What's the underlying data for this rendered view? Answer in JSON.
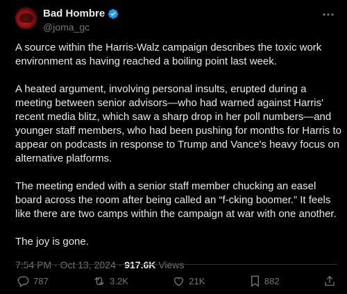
{
  "author": {
    "display_name": "Bad Hombre",
    "handle": "@joma_gc",
    "verified": true,
    "verified_color": "#1d9bf0"
  },
  "more_icon": "more-dots-icon",
  "tweet": {
    "paragraphs": [
      "A source within the Harris-Walz campaign describes the toxic work environment as having reached a boiling point last week.",
      "A heated argument, involving personal insults, erupted during a meeting between senior advisors—who had warned against Harris' recent media blitz, which saw a sharp drop in her poll numbers—and younger staff members, who had been pushing for months for Harris to appear on podcasts in response to Trump and Vance's heavy focus on alternative platforms.",
      "The meeting ended with a senior staff member chucking an easel board across the room after being called an “f-cking boomer.” It feels like there are two camps within the campaign at war with one another.",
      "The joy is gone."
    ]
  },
  "meta": {
    "time": "7:54 PM",
    "separator": "·",
    "date": "Oct 13, 2024",
    "views_count": "917.6K",
    "views_label": "Views"
  },
  "actions": {
    "replies": "787",
    "retweets": "3.2K",
    "likes": "21K",
    "bookmarks": "882"
  },
  "colors": {
    "background": "#000000",
    "text": "#e7e9ea",
    "muted": "#71767b",
    "divider": "#2f3336"
  }
}
